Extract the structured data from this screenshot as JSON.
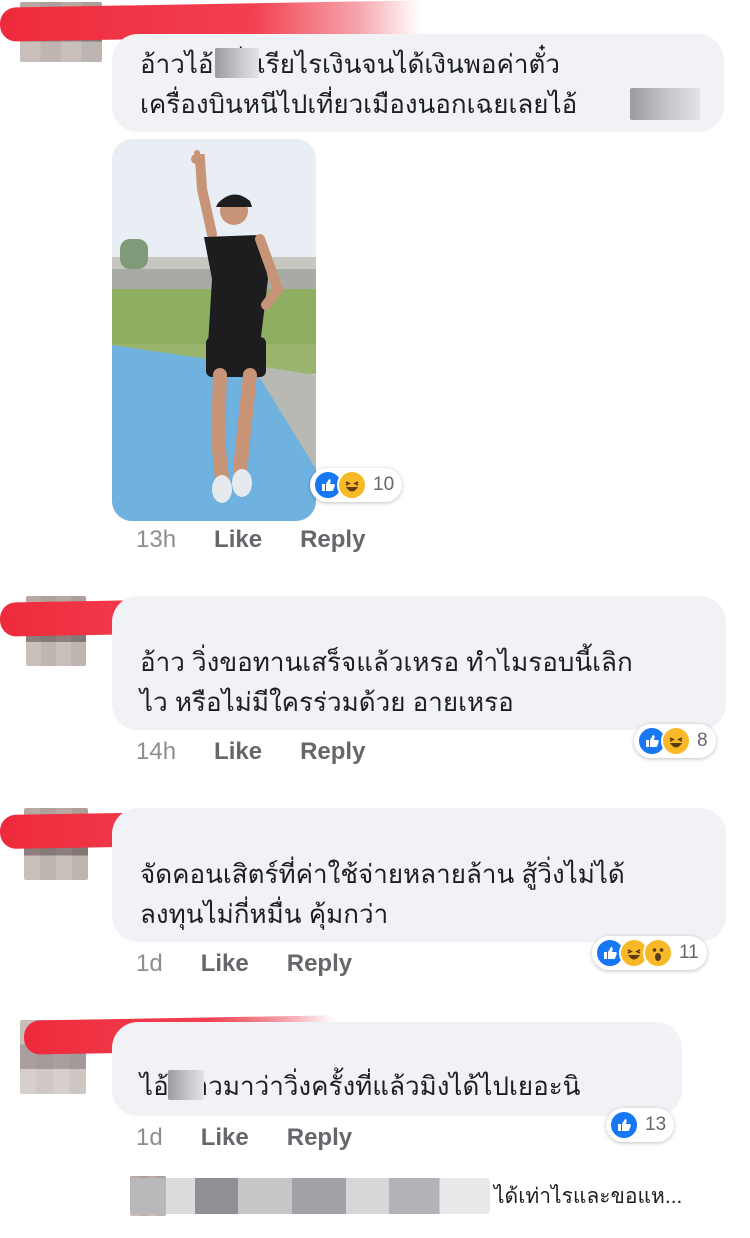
{
  "comments": [
    {
      "text": "อ้าวไอ้เ   วิ่งเรียไรเงินจนได้เงินพอค่าตั๋ว\nเครื่องบินหนีไปเที่ยวเมืองนอกเฉยเลยไอ้",
      "time": "13h",
      "like": "Like",
      "reply": "Reply",
      "reactions": [
        "like-icon",
        "haha-icon"
      ],
      "count": "10"
    },
    {
      "text": "อ้าว วิ่งขอทานเสร็จแล้วเหรอ ทำไมรอบนี้เลิก\nไว หรือไม่มีใครร่วมด้วย อายเหรอ",
      "time": "14h",
      "like": "Like",
      "reply": "Reply",
      "reactions": [
        "like-icon",
        "haha-icon"
      ],
      "count": "8"
    },
    {
      "text": "จัดคอนเสิตร์ที่ค่าใช้จ่ายหลายล้าน สู้วิ่งไม่ได้\nลงทุนไม่กี่หมื่น คุ้มกว่า",
      "time": "1d",
      "like": "Like",
      "reply": "Reply",
      "reactions": [
        "like-icon",
        "haha-icon",
        "wow-icon"
      ],
      "count": "11"
    },
    {
      "text": "ไอ้      ข่าวมาว่าวิ่งครั้งที่แล้วมิงได้ไปเยอะนิ",
      "time": "1d",
      "like": "Like",
      "reply": "Reply",
      "reactions": [
        "like-icon"
      ],
      "count": "13"
    }
  ],
  "preview": {
    "text": "ได้เท่าไรและขอแห..."
  },
  "colors": {
    "like": "#1877f2",
    "haha": "#f7b928",
    "bubble": "#f0f2f5",
    "redaction": "#ee2a3c"
  }
}
